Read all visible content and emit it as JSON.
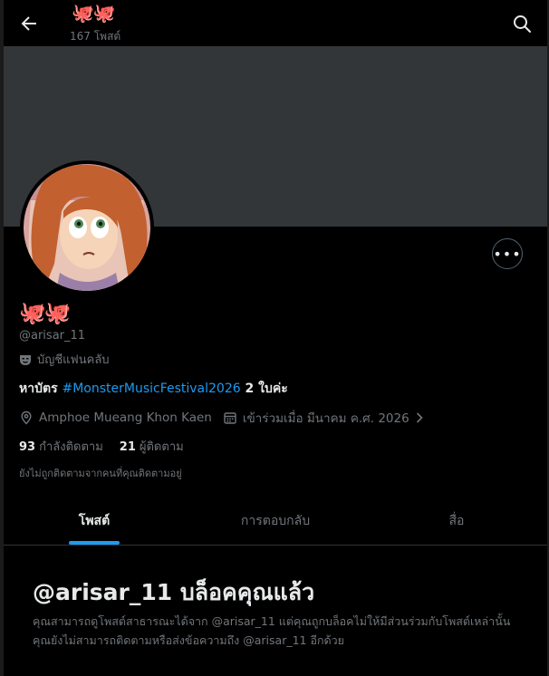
{
  "header": {
    "name_emoji": "🐙🐙",
    "post_count": "167 โพสต์"
  },
  "profile": {
    "display_name": "🐙🐙",
    "handle": "@arisar_11",
    "account_type": "บัญชีแฟนคลับ",
    "bio": {
      "prefix": "หาบัตร ",
      "hashtag": "#MonsterMusicFestival2026",
      "suffix": " 2 ใบค่ะ"
    },
    "location": "Amphoe Mueang Khon Kaen",
    "joined": "เข้าร่วมเมื่อ มีนาคม ค.ศ. 2026",
    "following_count": "93",
    "following_label": "กำลังติดตาม",
    "followers_count": "21",
    "followers_label": "ผู้ติดตาม",
    "not_followed": "ยังไม่ถูกติดตามจากคนที่คุณติดตามอยู่"
  },
  "tabs": [
    {
      "label": "โพสต์",
      "active": true
    },
    {
      "label": "การตอบกลับ",
      "active": false
    },
    {
      "label": "สื่อ",
      "active": false
    }
  ],
  "blocked": {
    "title": "@arisar_11 บล็อคคุณแล้ว",
    "message": "คุณสามารถดูโพสต์สาธารณะได้จาก @arisar_11 แต่คุณถูกบล็อคไม่ให้มีส่วนร่วมกับโพสต์เหล่านั้น คุณยังไม่สามารถติดตามหรือส่งข้อความถึง @arisar_11 อีกด้วย"
  },
  "icons": [
    "back-arrow-icon",
    "search-icon",
    "more-icon",
    "fan-mask-icon",
    "location-icon",
    "calendar-icon",
    "chevron-right-icon"
  ],
  "colors": {
    "accent": "#1d9bf0",
    "background": "#000000",
    "banner": "#333639",
    "muted": "#71767b"
  }
}
